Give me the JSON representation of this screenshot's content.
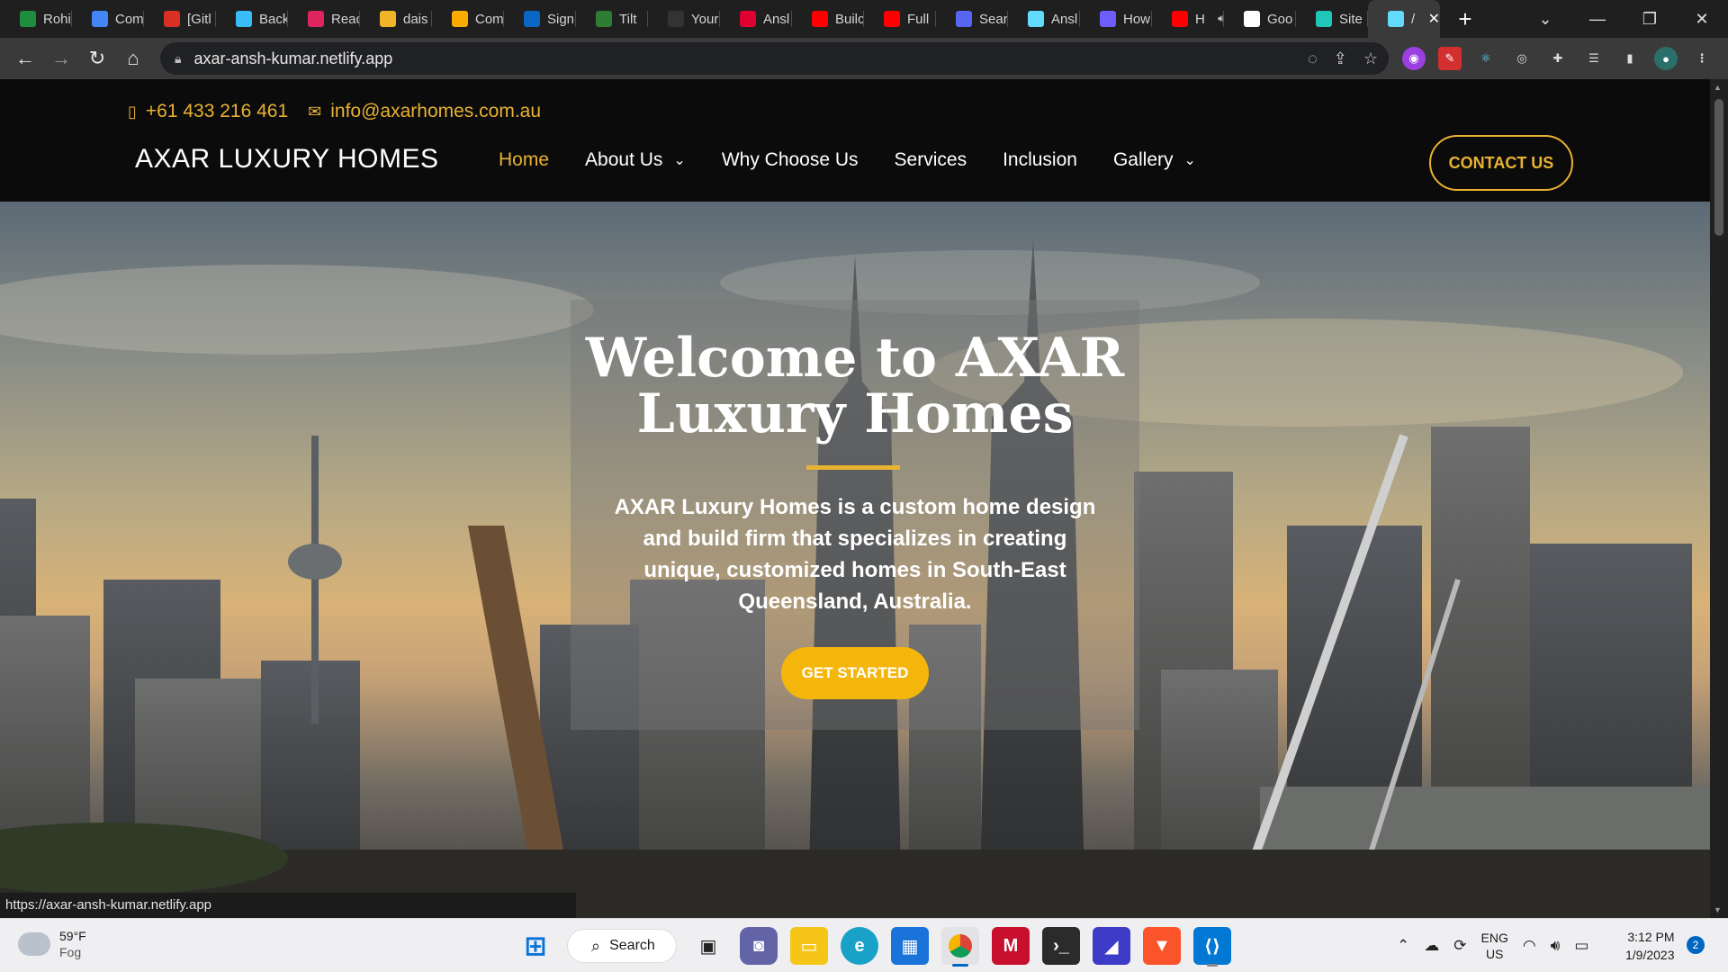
{
  "browser": {
    "tabs": [
      {
        "title": "Rohi",
        "favicon": "chat-icon",
        "color": "#1e8e3e"
      },
      {
        "title": "Com",
        "favicon": "docs-icon",
        "color": "#4285f4"
      },
      {
        "title": "[Gitl",
        "favicon": "gmail-icon",
        "color": "#d93025"
      },
      {
        "title": "Back",
        "favicon": "tailwind-icon",
        "color": "#38bdf8"
      },
      {
        "title": "Reac",
        "favicon": "react-icon",
        "color": "#e0245e"
      },
      {
        "title": "dais",
        "favicon": "daisyui-icon",
        "color": "#f0b429"
      },
      {
        "title": "Com",
        "favicon": "drive-icon",
        "color": "#f9ab00"
      },
      {
        "title": "Sign",
        "favicon": "linkedin-icon",
        "color": "#0a66c2"
      },
      {
        "title": "Tilt",
        "favicon": "tilt-icon",
        "color": "#2e7d32"
      },
      {
        "title": "Your",
        "favicon": "github-icon",
        "color": "#333333"
      },
      {
        "title": "Ansl",
        "favicon": "angular-icon",
        "color": "#dd0031"
      },
      {
        "title": "Builc",
        "favicon": "youtube-icon",
        "color": "#ff0000"
      },
      {
        "title": "Full",
        "favicon": "youtube-icon",
        "color": "#ff0000"
      },
      {
        "title": "Sear",
        "favicon": "search-icon",
        "color": "#5865f2"
      },
      {
        "title": "Ansl",
        "favicon": "react-icon",
        "color": "#61dafb"
      },
      {
        "title": "How",
        "favicon": "ai-icon",
        "color": "#6d5dfc"
      },
      {
        "title": "H",
        "favicon": "youtube-icon",
        "color": "#ff0000",
        "audio": true
      },
      {
        "title": "Goo",
        "favicon": "google-icon",
        "color": "#ffffff"
      },
      {
        "title": "Site",
        "favicon": "netlify-icon",
        "color": "#20c6b7"
      },
      {
        "title": "/",
        "favicon": "react-icon",
        "color": "#61dafb",
        "active": true
      }
    ],
    "new_tab_label": "+",
    "url": "axar-ansh-kumar.netlify.app",
    "status_url": "https://axar-ansh-kumar.netlify.app"
  },
  "site": {
    "phone": "+61 433 216 461",
    "email": "info@axarhomes.com.au",
    "brand": "AXAR LUXURY HOMES",
    "nav": {
      "home": "Home",
      "about": "About Us",
      "why": "Why Choose Us",
      "services": "Services",
      "inclusion": "Inclusion",
      "gallery": "Gallery"
    },
    "contact_button": "CONTACT US",
    "hero": {
      "title": "Welcome to AXAR Luxury Homes",
      "text": "AXAR Luxury Homes is a custom home design and build firm that specializes in creating unique, customized homes in South-East Queensland, Australia.",
      "button": "GET STARTED"
    },
    "colors": {
      "accent": "#e9b233",
      "button": "#f5b60c",
      "header_bg": "#0b0b0b"
    }
  },
  "taskbar": {
    "weather_temp": "59°F",
    "weather_desc": "Fog",
    "search_label": "Search",
    "lang_line1": "ENG",
    "lang_line2": "US",
    "time": "3:12 PM",
    "date": "1/9/2023",
    "notifications": "2"
  }
}
